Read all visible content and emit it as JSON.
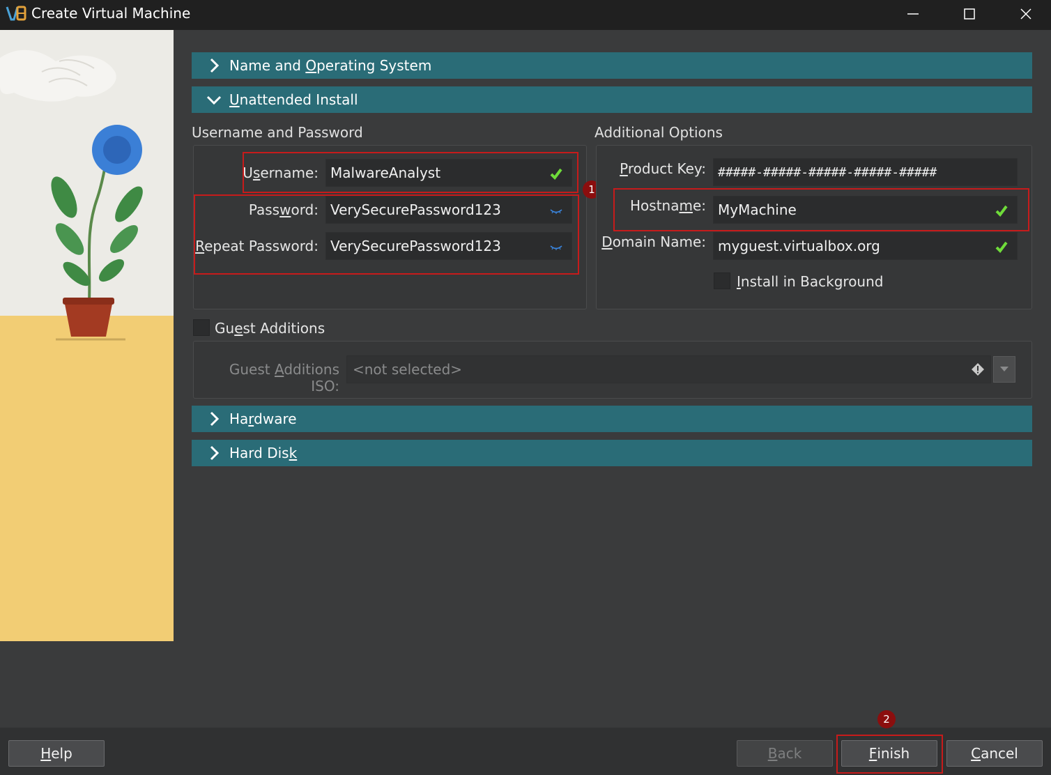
{
  "window": {
    "title": "Create Virtual Machine",
    "controls": [
      "minimize-icon",
      "maximize-icon",
      "close-icon"
    ]
  },
  "sections": {
    "name_os": {
      "label_pre": "Name and ",
      "label_u": "O",
      "label_post": "perating System",
      "expanded": false
    },
    "unattended": {
      "label_pre": "",
      "label_u": "U",
      "label_post": "nattended Install",
      "expanded": true
    },
    "hardware": {
      "label_pre": "Ha",
      "label_u": "r",
      "label_post": "dware",
      "expanded": false
    },
    "hard_disk": {
      "label_pre": "Hard Dis",
      "label_u": "k",
      "label_post": "",
      "expanded": false
    }
  },
  "credentials": {
    "group_title": "Username and Password",
    "username": {
      "label_pre": "U",
      "label_u": "s",
      "label_post": "ername:",
      "value": "MalwareAnalyst",
      "status": "check-icon"
    },
    "password": {
      "label_pre": "Pass",
      "label_u": "w",
      "label_post": "ord:",
      "value": "VerySecurePassword123",
      "status": "eye-closed-icon"
    },
    "repeat_password": {
      "label_pre": "",
      "label_u": "R",
      "label_post": "epeat Password:",
      "value": "VerySecurePassword123",
      "status": "eye-closed-icon"
    }
  },
  "additional": {
    "group_title": "Additional Options",
    "product_key": {
      "label_pre": "",
      "label_u": "P",
      "label_post": "roduct Key:",
      "value": "#####-#####-#####-#####-#####"
    },
    "hostname": {
      "label_pre": "Hostna",
      "label_u": "m",
      "label_post": "e:",
      "value": "MyMachine",
      "status": "check-icon"
    },
    "domain_name": {
      "label_pre": "",
      "label_u": "D",
      "label_post": "omain Name:",
      "value": "myguest.virtualbox.org",
      "status": "check-icon"
    },
    "install_background": {
      "label_pre": "",
      "label_u": "I",
      "label_post": "nstall in Background",
      "checked": false
    }
  },
  "guest_additions": {
    "label_pre": "Gu",
    "label_u": "e",
    "label_post": "st Additions",
    "checked": false,
    "iso_label_pre": "Guest ",
    "iso_label_u": "A",
    "iso_label_post": "dditions ISO:",
    "iso_value": "<not selected>"
  },
  "annotations": {
    "badge1": "1",
    "badge2": "2"
  },
  "buttons": {
    "help": {
      "pre": "",
      "u": "H",
      "post": "elp"
    },
    "back": {
      "pre": "",
      "u": "B",
      "post": "ack",
      "enabled": false
    },
    "finish": {
      "pre": "",
      "u": "F",
      "post": "inish"
    },
    "cancel": {
      "pre": "",
      "u": "C",
      "post": "ancel"
    }
  },
  "colors": {
    "accent": "#2a6c77",
    "highlight": "#c71b1b",
    "badge": "#8b0e0e",
    "valid": "#6fdc3a"
  }
}
